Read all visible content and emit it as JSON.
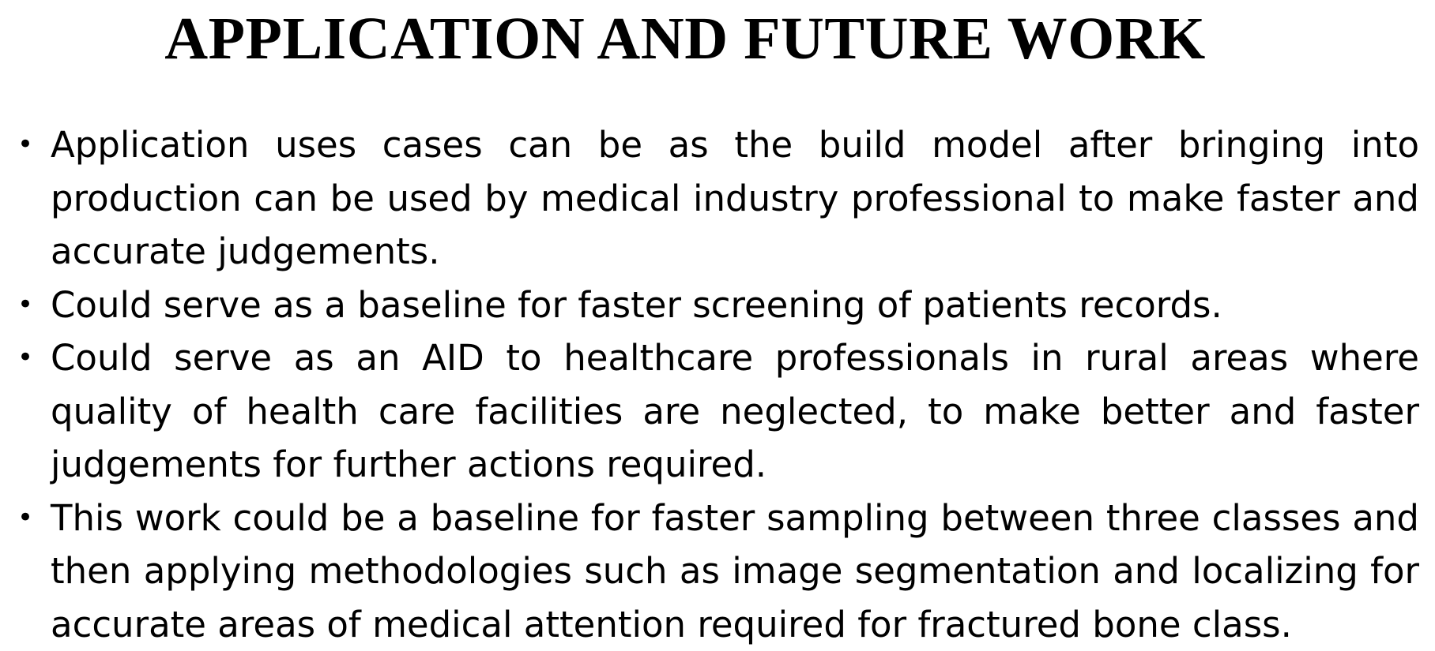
{
  "slide": {
    "title": "APPLICATION AND FUTURE WORK",
    "bullet_symbol": "•",
    "bullets": [
      "Application uses cases can be as the build model after bringing into production can be used by medical industry professional to make faster and accurate judgements.",
      "Could serve as a baseline for faster screening of patients records.",
      "Could serve as an AID to healthcare professionals in rural areas where quality of health care facilities are neglected, to make better and faster judgements for further actions required.",
      "This work could be a baseline for faster sampling between three classes and then applying methodologies such as image segmentation and localizing for accurate areas of medical attention required for fractured bone class."
    ]
  }
}
